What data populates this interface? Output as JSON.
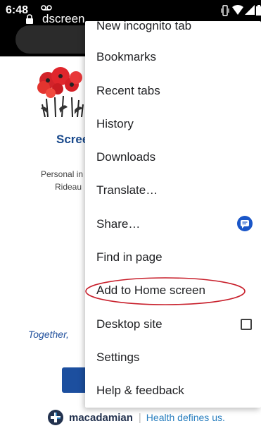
{
  "status_bar": {
    "time": "6:48"
  },
  "address_bar": {
    "url_text": "dscreen"
  },
  "background_page": {
    "title_fragment": "Scree",
    "line1_fragment": "Personal in",
    "line2_fragment": "Rideau",
    "tagline_fragment": "Together, ",
    "footer_brand_name": "macadamian",
    "footer_divider": "|",
    "footer_slogan": "Health defines us."
  },
  "menu": {
    "items": [
      {
        "label": "New incognito tab"
      },
      {
        "label": "Bookmarks"
      },
      {
        "label": "Recent tabs"
      },
      {
        "label": "History"
      },
      {
        "label": "Downloads"
      },
      {
        "label": "Translate…"
      },
      {
        "label": "Share…"
      },
      {
        "label": "Find in page"
      },
      {
        "label": "Add to Home screen"
      },
      {
        "label": "Desktop site"
      },
      {
        "label": "Settings"
      },
      {
        "label": "Help & feedback"
      }
    ]
  },
  "colors": {
    "highlight_oval": "#c8202c",
    "share_icon": "#1a56c8",
    "brand_navy": "#23324f",
    "brand_blue": "#2a7fbf"
  }
}
